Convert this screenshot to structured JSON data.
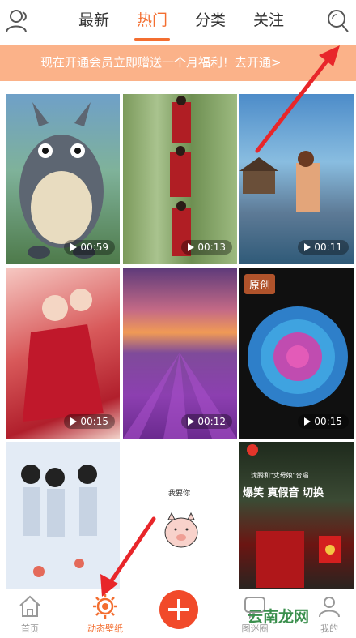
{
  "header": {
    "tabs": [
      {
        "label": "最新",
        "active": false
      },
      {
        "label": "热门",
        "active": true
      },
      {
        "label": "分类",
        "active": false
      },
      {
        "label": "关注",
        "active": false
      }
    ],
    "icons": [
      "user-icon",
      "search-icon"
    ]
  },
  "banner": {
    "text": "现在开通会员立即赠送一个月福利！去开通>"
  },
  "grid": {
    "items": [
      {
        "name": "totoro-wallpaper",
        "duration": "00:59",
        "badge": ""
      },
      {
        "name": "red-dress-bamboo-wallpaper",
        "duration": "00:13",
        "badge": ""
      },
      {
        "name": "beach-hut-girl-wallpaper",
        "duration": "00:11",
        "badge": ""
      },
      {
        "name": "red-couple-wallpaper",
        "duration": "00:15",
        "badge": ""
      },
      {
        "name": "lavender-sunset-wallpaper",
        "duration": "00:12",
        "badge": ""
      },
      {
        "name": "blue-dahlia-wallpaper",
        "duration": "00:15",
        "badge": "原创"
      },
      {
        "name": "sketch-couple-wallpaper",
        "duration": "",
        "badge": ""
      },
      {
        "name": "pig-cartoon-wallpaper",
        "duration": "",
        "badge": "",
        "caption": "我要你"
      },
      {
        "name": "weibo-video-wallpaper",
        "duration": "",
        "badge": "",
        "caption_top": "沈腾和\"丈母娘\"合唱",
        "caption_main": "爆笑 真假音 切换"
      }
    ]
  },
  "bottom_nav": {
    "items": [
      {
        "label": "首页",
        "icon": "home-icon",
        "active": false
      },
      {
        "label": "动态壁纸",
        "icon": "sun-gear-icon",
        "active": true
      },
      {
        "label": "",
        "icon": "plus-icon",
        "active": false
      },
      {
        "label": "图迷圈",
        "icon": "chat-icon",
        "active": false
      },
      {
        "label": "我的",
        "icon": "profile-icon",
        "active": false
      }
    ]
  },
  "watermark": "云南龙网",
  "colors": {
    "accent": "#f36e30",
    "banner": "#fbb289",
    "fab": "#f14a2a",
    "arrow": "#e8262a"
  }
}
